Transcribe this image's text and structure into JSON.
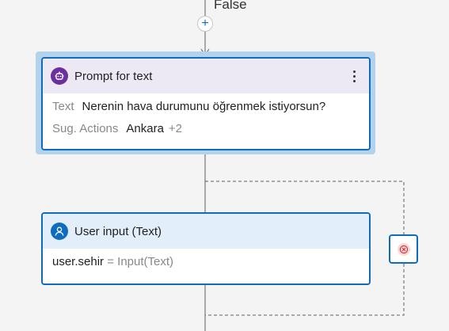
{
  "branch": {
    "label": "False",
    "add_button": "+"
  },
  "prompt_node": {
    "title": "Prompt for text",
    "icon": "bot-icon",
    "text_label": "Text",
    "text_value": "Nerenin hava durumunu öğrenmek istiyorsun?",
    "actions_label": "Sug. Actions",
    "actions_value": "Ankara",
    "actions_extra": "+2",
    "more_icon": "more-vertical-icon"
  },
  "input_node": {
    "title": "User input (Text)",
    "icon": "person-icon",
    "variable": "user.sehir",
    "operator": "=",
    "expression": "Input(Text)"
  },
  "close_control": {
    "icon": "dismiss-circle-icon",
    "color": "#c4314b"
  },
  "colors": {
    "accent": "#0f6cbd",
    "prompt_header": "#ece9f4",
    "input_header": "#e3eefb",
    "bot_icon": "#6b2fa0"
  }
}
